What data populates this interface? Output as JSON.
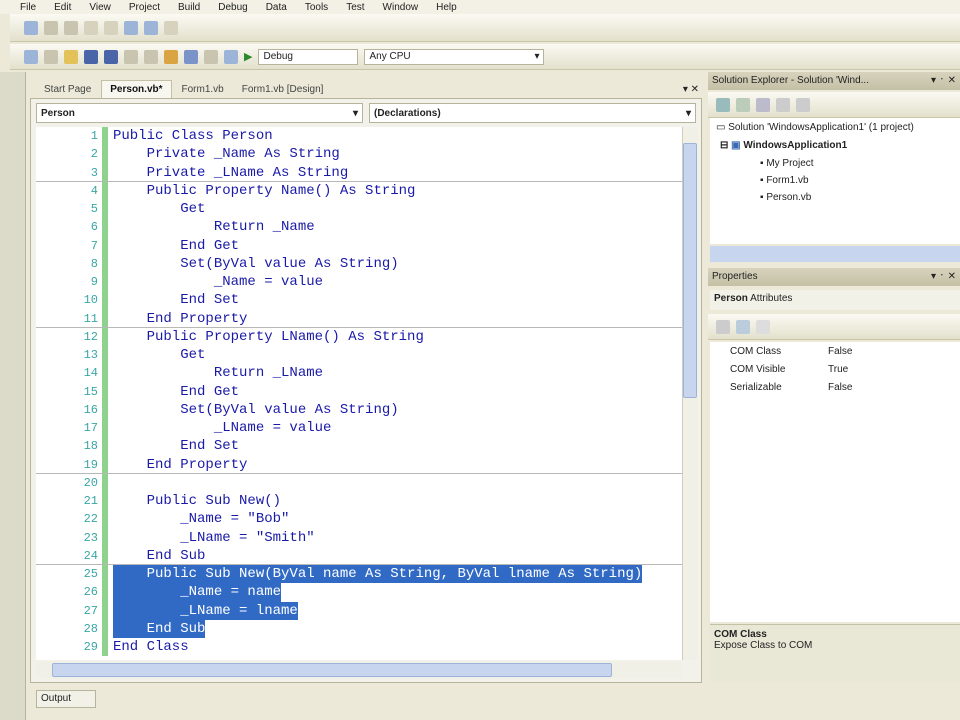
{
  "menu": [
    "File",
    "Edit",
    "View",
    "Project",
    "Build",
    "Debug",
    "Data",
    "Tools",
    "Test",
    "Window",
    "Help"
  ],
  "toolbar": {
    "config": "Debug",
    "platform": "Any CPU"
  },
  "tabs": [
    "Start Page",
    "Person.vb*",
    "Form1.vb",
    "Form1.vb [Design]"
  ],
  "nav": {
    "class_combo": "Person",
    "member_combo": "(Declarations)"
  },
  "code": [
    {
      "n": "1",
      "t": "Public Class Person"
    },
    {
      "n": "2",
      "t": "    Private _Name As String"
    },
    {
      "n": "3",
      "t": "    Private _LName As String",
      "sep": true
    },
    {
      "n": "4",
      "t": "    Public Property Name() As String"
    },
    {
      "n": "5",
      "t": "        Get"
    },
    {
      "n": "6",
      "t": "            Return _Name"
    },
    {
      "n": "7",
      "t": "        End Get"
    },
    {
      "n": "8",
      "t": "        Set(ByVal value As String)"
    },
    {
      "n": "9",
      "t": "            _Name = value"
    },
    {
      "n": "10",
      "t": "        End Set"
    },
    {
      "n": "11",
      "t": "    End Property",
      "sep": true
    },
    {
      "n": "12",
      "t": "    Public Property LName() As String"
    },
    {
      "n": "13",
      "t": "        Get"
    },
    {
      "n": "14",
      "t": "            Return _LName"
    },
    {
      "n": "15",
      "t": "        End Get"
    },
    {
      "n": "16",
      "t": "        Set(ByVal value As String)"
    },
    {
      "n": "17",
      "t": "            _LName = value"
    },
    {
      "n": "18",
      "t": "        End Set"
    },
    {
      "n": "19",
      "t": "    End Property",
      "sep": true
    },
    {
      "n": "20",
      "t": ""
    },
    {
      "n": "21",
      "t": "    Public Sub New()"
    },
    {
      "n": "22",
      "t": "        _Name = \"Bob\""
    },
    {
      "n": "23",
      "t": "        _LName = \"Smith\""
    },
    {
      "n": "24",
      "t": "    End Sub",
      "sep": true
    },
    {
      "n": "25",
      "t": "    Public Sub New(ByVal name As String, ByVal lname As String)",
      "sel": true
    },
    {
      "n": "26",
      "t": "        _Name = name",
      "sel": true
    },
    {
      "n": "27",
      "t": "        _LName = lname",
      "sel": true
    },
    {
      "n": "28",
      "t": "    End Sub",
      "sel": true
    },
    {
      "n": "29",
      "t": "End Class"
    }
  ],
  "output_tab": "Output",
  "solution_explorer": {
    "title": "Solution Explorer - Solution 'Wind...",
    "solution": "Solution 'WindowsApplication1' (1 project)",
    "project": "WindowsApplication1",
    "items": [
      "My Project",
      "Form1.vb",
      "Person.vb"
    ]
  },
  "properties": {
    "title": "Properties",
    "object": "Person",
    "object_type": "Attributes",
    "rows": [
      {
        "name": "COM Class",
        "value": "False"
      },
      {
        "name": "COM Visible",
        "value": "True"
      },
      {
        "name": "Serializable",
        "value": "False"
      }
    ],
    "desc_title": "COM Class",
    "desc_text": "Expose Class to COM"
  }
}
